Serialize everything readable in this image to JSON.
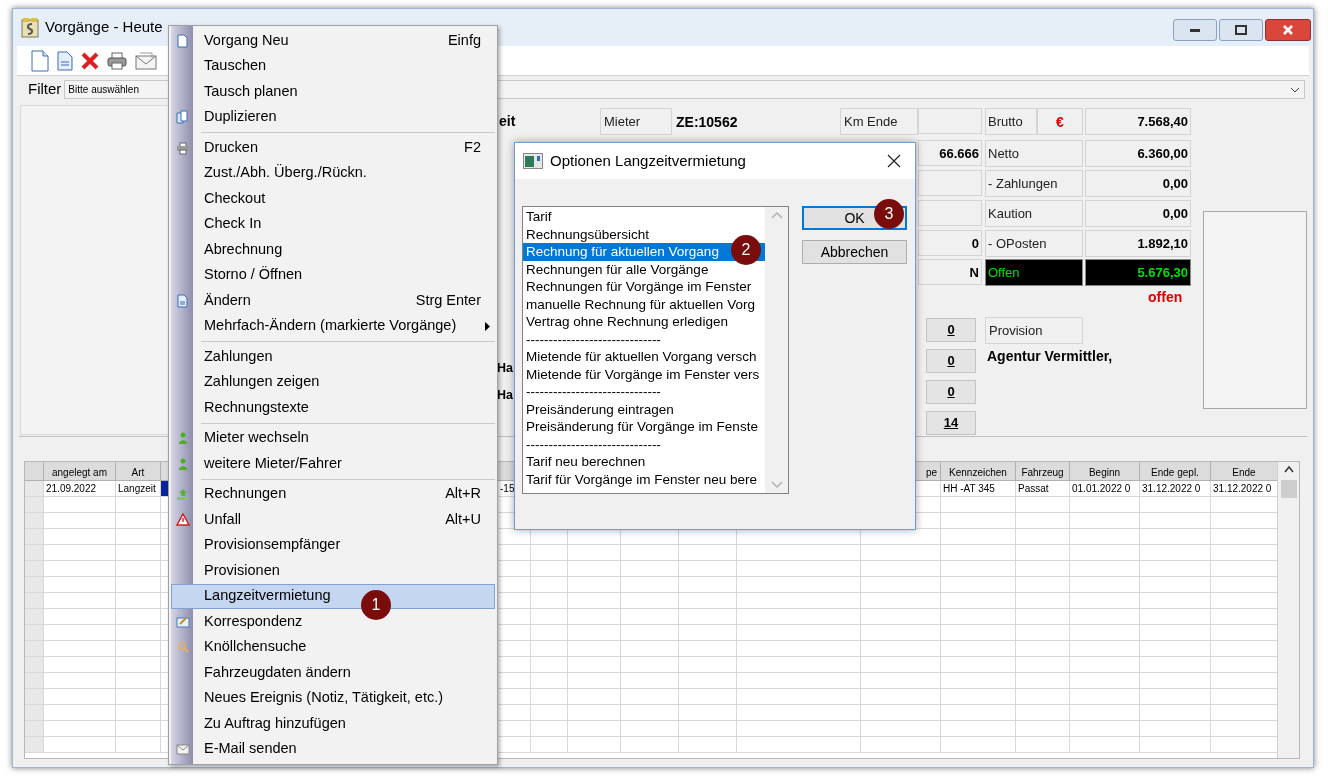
{
  "window": {
    "title": "Vorgänge - Heute"
  },
  "filter": {
    "label": "Filter",
    "value": "Bitte auswählen"
  },
  "form": {
    "partial_labels": [
      "eit",
      "Ha",
      "Ha"
    ],
    "mieter": {
      "label": "Mieter",
      "value": "ZE:10562"
    },
    "km_ende": {
      "label": "Km Ende"
    },
    "value_boxes": [
      "66.666",
      "0",
      "N"
    ],
    "totals": [
      {
        "label": "Brutto",
        "currency": "€",
        "value": "7.568,40"
      },
      {
        "label": "Netto",
        "value": "6.360,00"
      },
      {
        "label": "- Zahlungen",
        "value": "0,00"
      },
      {
        "label": "Kaution",
        "value": "0,00"
      },
      {
        "label": "- OPosten",
        "value": "1.892,10"
      },
      {
        "label": "Offen",
        "value": "5.676,30",
        "highlight": true
      }
    ],
    "status": "offen",
    "count_buttons": [
      "0",
      "0",
      "0",
      "14"
    ],
    "provision": {
      "label": "Provision",
      "value": "Agentur Vermittler,"
    }
  },
  "table": {
    "columns": [
      {
        "label": "angelegt am"
      },
      {
        "label": "Art"
      },
      {
        "label": "pe"
      },
      {
        "label": "Kennzeichen"
      },
      {
        "label": "Fahrzeug"
      },
      {
        "label": "Beginn"
      },
      {
        "label": "Ende gepl."
      },
      {
        "label": "Ende"
      }
    ],
    "rows": [
      {
        "selected": true,
        "angelegt_am": "21.09.2022",
        "art": "Langzeit",
        "column_4": "-15",
        "kennzeichen": "HH -AT 345",
        "fahrzeug": "Passat",
        "beginn": "01.01.2022 0",
        "ende_gepl": "31.12.2022 0",
        "ende": "31.12.2022 0"
      }
    ]
  },
  "context_menu": {
    "groups": [
      [
        {
          "label": "Vorgang Neu",
          "shortcut": "Einfg",
          "selected": false
        },
        {
          "label": "Tauschen",
          "selected": false
        },
        {
          "label": "Tausch planen",
          "selected": false
        },
        {
          "label": "Duplizieren",
          "selected": false
        }
      ],
      [
        {
          "label": "Drucken",
          "shortcut": "F2",
          "selected": false
        },
        {
          "label": "Zust./Abh. Überg./Rückn.",
          "selected": false
        },
        {
          "label": "Checkout",
          "selected": false
        },
        {
          "label": "Check In",
          "selected": false
        },
        {
          "label": "Abrechnung",
          "selected": false
        },
        {
          "label": "Storno / Öffnen",
          "selected": false
        },
        {
          "label": "Ändern",
          "shortcut": "Strg Enter",
          "selected": false
        },
        {
          "label": "Mehrfach-Ändern (markierte Vorgänge)",
          "submenu": true,
          "selected": false
        }
      ],
      [
        {
          "label": "Zahlungen",
          "selected": false
        },
        {
          "label": "Zahlungen zeigen",
          "selected": false
        },
        {
          "label": "Rechnungstexte",
          "selected": false
        }
      ],
      [
        {
          "label": "Mieter wechseln",
          "selected": false
        },
        {
          "label": "weitere Mieter/Fahrer",
          "selected": false
        }
      ],
      [
        {
          "label": "Rechnungen",
          "shortcut": "Alt+R",
          "selected": false
        },
        {
          "label": "Unfall",
          "shortcut": "Alt+U",
          "selected": false
        },
        {
          "label": "Provisionsempfänger",
          "selected": false
        },
        {
          "label": "Provisionen",
          "selected": false
        },
        {
          "label": "Langzeitvermietung",
          "selected": true
        },
        {
          "label": "Korrespondenz",
          "selected": false
        },
        {
          "label": "Knöllchensuche",
          "selected": false
        },
        {
          "label": "Fahrzeugdaten ändern",
          "selected": false
        },
        {
          "label": "Neues Ereignis (Notiz, Tätigkeit, etc.)",
          "selected": false
        },
        {
          "label": "Zu Auftrag hinzufügen",
          "selected": false
        },
        {
          "label": "E-Mail senden",
          "selected": false
        }
      ]
    ]
  },
  "dialog": {
    "title": "Optionen Langzeitvermietung",
    "options": [
      {
        "label": "Tarif",
        "selected": false
      },
      {
        "label": "Rechnungsübersicht",
        "selected": false
      },
      {
        "label": "Rechnung für aktuellen Vorgang",
        "selected": true
      },
      {
        "label": "Rechnungen für alle Vorgänge",
        "selected": false
      },
      {
        "label": "Rechnungen für Vorgänge im Fenster",
        "selected": false
      },
      {
        "label": "manuelle Rechnung für aktuellen Vorg",
        "selected": false
      },
      {
        "label": "Vertrag ohne Rechnung erledigen",
        "selected": false
      },
      {
        "label": "------------------------------",
        "selected": false
      },
      {
        "label": "Mietende für aktuellen Vorgang versch",
        "selected": false
      },
      {
        "label": "Mietende für Vorgänge im Fenster vers",
        "selected": false
      },
      {
        "label": "------------------------------",
        "selected": false
      },
      {
        "label": "Preisänderung eintragen",
        "selected": false
      },
      {
        "label": "Preisänderung für Vorgänge im Fenste",
        "selected": false
      },
      {
        "label": "------------------------------",
        "selected": false
      },
      {
        "label": "Tarif neu berechnen",
        "selected": false
      },
      {
        "label": "Tarif für Vorgänge im Fenster neu bere",
        "selected": false
      }
    ],
    "buttons": [
      {
        "label": "OK",
        "default": true
      },
      {
        "label": "Abbrechen",
        "default": false
      }
    ]
  },
  "callouts": [
    "1",
    "2",
    "3"
  ]
}
